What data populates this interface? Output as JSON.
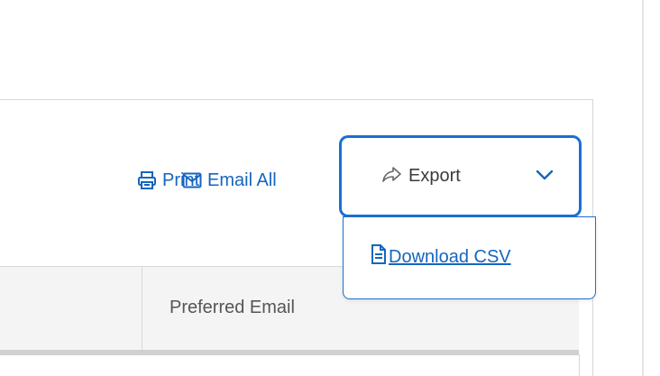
{
  "toolbar": {
    "print_label": "Print",
    "email_all_label": "Email All",
    "export": {
      "label": "Export",
      "menu_items": [
        {
          "label": "Download CSV",
          "icon": "document-icon"
        }
      ]
    }
  },
  "table": {
    "columns": [
      "Preferred Email"
    ]
  },
  "colors": {
    "link": "#1565c0",
    "focus_border": "#1a6fd0",
    "header_bg": "#f4f4f4"
  }
}
